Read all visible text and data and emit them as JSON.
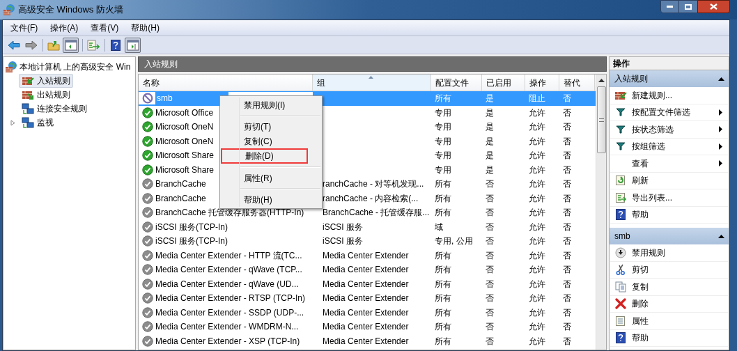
{
  "window": {
    "title": "高级安全 Windows 防火墙"
  },
  "menu": [
    "文件(F)",
    "操作(A)",
    "查看(V)",
    "帮助(H)"
  ],
  "toolbar": [
    {
      "pressed": false
    },
    {
      "pressed": false
    },
    {
      "pressed": false
    },
    {
      "pressed": true
    },
    {
      "pressed": false
    },
    {
      "pressed": false
    },
    {
      "pressed": true
    }
  ],
  "tree": {
    "label": "本地计算机 上的高级安全 Win",
    "children": [
      {
        "label": "入站规则",
        "selected": true
      },
      {
        "label": "出站规则",
        "selected": false
      },
      {
        "label": "连接安全规则",
        "selected": false
      },
      {
        "label": "监视",
        "selected": false,
        "expanded": false
      }
    ]
  },
  "center": {
    "title": "入站规则",
    "columns": [
      "名称",
      "组",
      "配置文件",
      "已启用",
      "操作",
      "替代"
    ],
    "rows": [
      {
        "name": "smb",
        "group": "",
        "profile": "所有",
        "enabled_text": "是",
        "action": "阻止",
        "override": "否",
        "enabled": true,
        "blocked": true,
        "selected": true
      },
      {
        "name": "Microsoft Office",
        "group": "",
        "profile": "专用",
        "enabled_text": "是",
        "action": "允许",
        "override": "否",
        "enabled": true,
        "blocked": false,
        "selected": false
      },
      {
        "name": "Microsoft OneN",
        "group": "",
        "profile": "专用",
        "enabled_text": "是",
        "action": "允许",
        "override": "否",
        "enabled": true,
        "blocked": false,
        "selected": false
      },
      {
        "name": "Microsoft OneN",
        "group": "",
        "profile": "专用",
        "enabled_text": "是",
        "action": "允许",
        "override": "否",
        "enabled": true,
        "blocked": false,
        "selected": false
      },
      {
        "name": "Microsoft Share",
        "group": "",
        "profile": "专用",
        "enabled_text": "是",
        "action": "允许",
        "override": "否",
        "enabled": true,
        "blocked": false,
        "selected": false
      },
      {
        "name": "Microsoft Share",
        "group": "",
        "profile": "专用",
        "enabled_text": "是",
        "action": "允许",
        "override": "否",
        "enabled": true,
        "blocked": false,
        "selected": false
      },
      {
        "name": "BranchCache",
        "group": "ranchCache - 对等机发现...",
        "profile": "所有",
        "enabled_text": "否",
        "action": "允许",
        "override": "否",
        "enabled": false,
        "blocked": false,
        "selected": false
      },
      {
        "name": "BranchCache",
        "group": "ranchCache - 内容检索(...",
        "profile": "所有",
        "enabled_text": "否",
        "action": "允许",
        "override": "否",
        "enabled": false,
        "blocked": false,
        "selected": false
      },
      {
        "name": "BranchCache 托管缓存服务器(HTTP-In)",
        "group": "BranchCache - 托管缓存服...",
        "profile": "所有",
        "enabled_text": "否",
        "action": "允许",
        "override": "否",
        "enabled": false,
        "blocked": false,
        "selected": false
      },
      {
        "name": "iSCSI 服务(TCP-In)",
        "group": "iSCSI 服务",
        "profile": "域",
        "enabled_text": "否",
        "action": "允许",
        "override": "否",
        "enabled": false,
        "blocked": false,
        "selected": false
      },
      {
        "name": "iSCSI 服务(TCP-In)",
        "group": "iSCSI 服务",
        "profile": "专用, 公用",
        "enabled_text": "否",
        "action": "允许",
        "override": "否",
        "enabled": false,
        "blocked": false,
        "selected": false
      },
      {
        "name": "Media Center Extender - HTTP 流(TC...",
        "group": "Media Center Extender",
        "profile": "所有",
        "enabled_text": "否",
        "action": "允许",
        "override": "否",
        "enabled": false,
        "blocked": false,
        "selected": false
      },
      {
        "name": "Media Center Extender - qWave (TCP...",
        "group": "Media Center Extender",
        "profile": "所有",
        "enabled_text": "否",
        "action": "允许",
        "override": "否",
        "enabled": false,
        "blocked": false,
        "selected": false
      },
      {
        "name": "Media Center Extender - qWave (UD...",
        "group": "Media Center Extender",
        "profile": "所有",
        "enabled_text": "否",
        "action": "允许",
        "override": "否",
        "enabled": false,
        "blocked": false,
        "selected": false
      },
      {
        "name": "Media Center Extender - RTSP (TCP-In)",
        "group": "Media Center Extender",
        "profile": "所有",
        "enabled_text": "否",
        "action": "允许",
        "override": "否",
        "enabled": false,
        "blocked": false,
        "selected": false
      },
      {
        "name": "Media Center Extender - SSDP (UDP-...",
        "group": "Media Center Extender",
        "profile": "所有",
        "enabled_text": "否",
        "action": "允许",
        "override": "否",
        "enabled": false,
        "blocked": false,
        "selected": false
      },
      {
        "name": "Media Center Extender - WMDRM-N...",
        "group": "Media Center Extender",
        "profile": "所有",
        "enabled_text": "否",
        "action": "允许",
        "override": "否",
        "enabled": false,
        "blocked": false,
        "selected": false
      },
      {
        "name": "Media Center Extender - XSP (TCP-In)",
        "group": "Media Center Extender",
        "profile": "所有",
        "enabled_text": "否",
        "action": "允许",
        "override": "否",
        "enabled": false,
        "blocked": false,
        "selected": false
      }
    ]
  },
  "context_menu": [
    {
      "label": "禁用规则(I)",
      "highlighted": false,
      "separator_after": true
    },
    {
      "label": "剪切(T)",
      "highlighted": false,
      "separator_after": false
    },
    {
      "label": "复制(C)",
      "highlighted": false,
      "separator_after": false
    },
    {
      "label": "删除(D)",
      "highlighted": true,
      "separator_after": true
    },
    {
      "label": "属性(R)",
      "highlighted": false,
      "separator_after": true
    },
    {
      "label": "帮助(H)",
      "highlighted": false,
      "separator_after": false
    }
  ],
  "actions": {
    "title": "操作",
    "sections": [
      {
        "title": "入站规则",
        "expanded": true,
        "items": [
          {
            "label": "新建规则...",
            "submenu": false
          },
          {
            "label": "按配置文件筛选",
            "submenu": true
          },
          {
            "label": "按状态筛选",
            "submenu": true
          },
          {
            "label": "按组筛选",
            "submenu": true
          },
          {
            "label": "查看",
            "submenu": true
          },
          {
            "label": "刷新",
            "submenu": false
          },
          {
            "label": "导出列表...",
            "submenu": false
          },
          {
            "label": "帮助",
            "submenu": false
          }
        ]
      },
      {
        "title": "smb",
        "expanded": true,
        "items": [
          {
            "label": "禁用规则",
            "submenu": false
          },
          {
            "label": "剪切",
            "submenu": false
          },
          {
            "label": "复制",
            "submenu": false
          },
          {
            "label": "删除",
            "submenu": false
          },
          {
            "label": "属性",
            "submenu": false
          },
          {
            "label": "帮助",
            "submenu": false
          }
        ]
      }
    ]
  }
}
